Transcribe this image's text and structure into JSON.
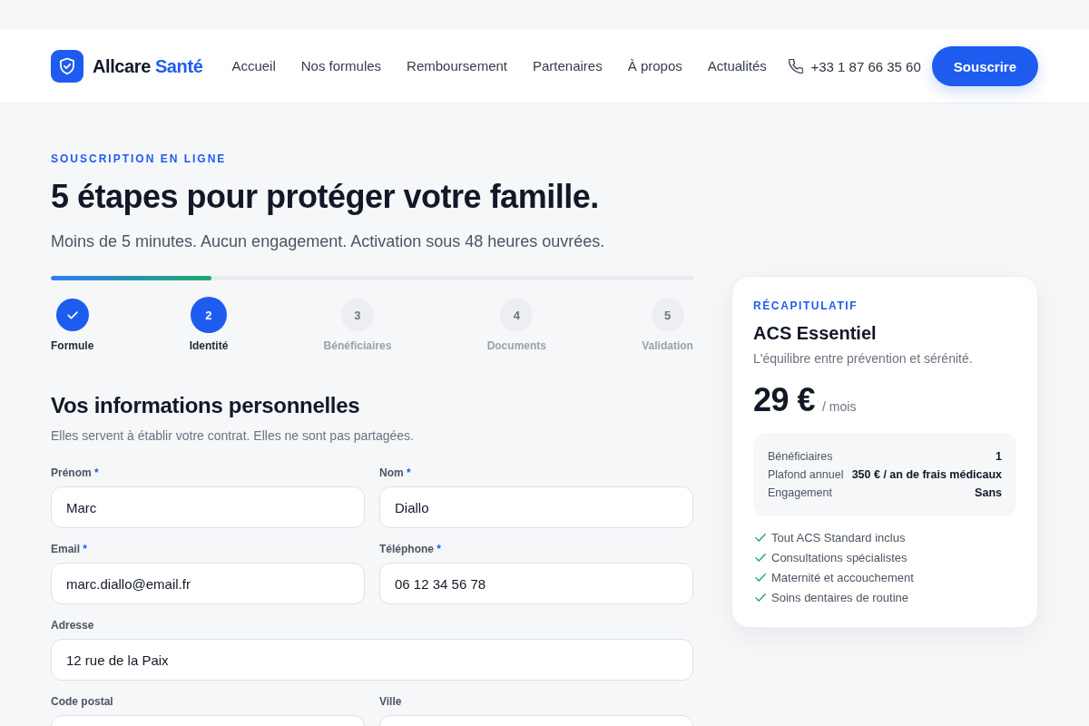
{
  "header": {
    "brand": {
      "name": "Allcare",
      "accent": "Santé"
    },
    "nav": [
      "Accueil",
      "Nos formules",
      "Remboursement",
      "Partenaires",
      "À propos",
      "Actualités"
    ],
    "phone": "+33 1 87 66 35 60",
    "cta": "Souscrire"
  },
  "intro": {
    "eyebrow": "SOUSCRIPTION EN LIGNE",
    "title": "5 étapes pour protéger votre famille.",
    "subtitle": "Moins de 5 minutes. Aucun engagement. Activation sous 48 heures ouvrées."
  },
  "progress": {
    "level": 0.25
  },
  "steps": [
    {
      "label": "Formule",
      "completed": true,
      "selected": false
    },
    {
      "number": "2",
      "label": "Identité",
      "completed": false,
      "selected": true
    },
    {
      "number": "3",
      "label": "Bénéficiaires",
      "completed": false,
      "selected": false
    },
    {
      "number": "4",
      "label": "Documents",
      "completed": false,
      "selected": false
    },
    {
      "number": "5",
      "label": "Validation",
      "completed": false,
      "selected": false
    }
  ],
  "form": {
    "title": "Vos informations personnelles",
    "subtitle": "Elles servent à établir votre contrat. Elles ne sont pas partagées.",
    "rows": [
      {
        "fields": [
          {
            "label": "Prénom",
            "required_mark": "*",
            "value": "Marc"
          },
          {
            "label": "Nom",
            "required_mark": "*",
            "value": "Diallo"
          }
        ]
      },
      {
        "fields": [
          {
            "label": "Email",
            "required_mark": "*",
            "value": "marc.diallo@email.fr"
          },
          {
            "label": "Téléphone",
            "required_mark": "*",
            "value": "06 12 34 56 78"
          }
        ]
      },
      {
        "fields": [
          {
            "label": "Adresse",
            "value": "12 rue de la Paix"
          }
        ]
      },
      {
        "fields": [
          {
            "label": "Code postal"
          },
          {
            "label": "Ville"
          }
        ]
      }
    ]
  },
  "summary": {
    "eyebrow": "RÉCAPITULATIF",
    "plan": "ACS Essentiel",
    "tagline": "L'équilibre entre prévention et sérénité.",
    "price": "29 €",
    "period": "/ mois",
    "details": [
      {
        "label": "Bénéficiaires",
        "value": "1"
      },
      {
        "label": "Plafond annuel",
        "value": "350 € / an de frais médicaux"
      },
      {
        "label": "Engagement",
        "value": "Sans"
      }
    ],
    "features": [
      "Tout ACS Standard inclus",
      "Consultations spécialistes",
      "Maternité et accouchement",
      "Soins dentaires de routine"
    ]
  }
}
